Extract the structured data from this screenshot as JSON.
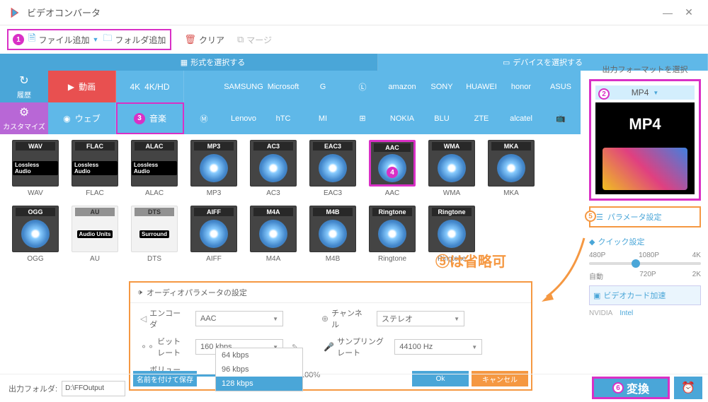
{
  "titlebar": {
    "title": "ビデオコンバータ"
  },
  "toolbar": {
    "add_file": "ファイル追加",
    "add_folder": "フォルダ追加",
    "clear": "クリア",
    "merge": "マージ",
    "num1": "1"
  },
  "tabs": {
    "format": "形式を選択する",
    "device": "デバイスを選択する"
  },
  "sidebar": {
    "history": "履歴",
    "customize": "カスタマイズ"
  },
  "cats": {
    "video": "動画",
    "video4k": "4K/HD",
    "web": "ウェブ",
    "music": "音楽",
    "num3": "3"
  },
  "brands_row1": [
    "",
    "SAMSUNG",
    "Microsoft",
    "G",
    "",
    "amazon",
    "SONY",
    "HUAWEI",
    "honor",
    "ASUS"
  ],
  "brands_row2": [
    "",
    "Lenovo",
    "hTC",
    "MI",
    "",
    "NOKIA",
    "BLU",
    "ZTE",
    "alcatel",
    "TV"
  ],
  "formats": [
    {
      "name": "WAV",
      "light": false,
      "sub": "Lossless Audio"
    },
    {
      "name": "FLAC",
      "light": false,
      "sub": "Lossless Audio"
    },
    {
      "name": "ALAC",
      "light": false,
      "sub": "Lossless Audio"
    },
    {
      "name": "MP3",
      "light": false
    },
    {
      "name": "AC3",
      "light": false
    },
    {
      "name": "EAC3",
      "light": false
    },
    {
      "name": "AAC",
      "light": false,
      "hl": true,
      "num": "4"
    },
    {
      "name": "WMA",
      "light": false
    },
    {
      "name": "MKA",
      "light": false
    },
    {
      "name": "OGG",
      "light": false
    },
    {
      "name": "AU",
      "light": true,
      "sub": "Audio Units"
    },
    {
      "name": "DTS",
      "light": true,
      "sub": "Surround"
    },
    {
      "name": "AIFF",
      "light": false
    },
    {
      "name": "M4A",
      "light": false
    },
    {
      "name": "M4B",
      "light": false
    },
    {
      "name": "Ringtone",
      "light": false,
      "icon": "apple"
    },
    {
      "name": "Ringtone",
      "light": false,
      "icon": "android"
    }
  ],
  "right": {
    "title": "出力フォーマットを選択",
    "format": "MP4",
    "thumb_text": "MP4",
    "num2": "2",
    "param_btn": "パラメータ設定",
    "num5": "5",
    "quick_title": "クイック設定",
    "presets1": [
      "480P",
      "1080P",
      "4K"
    ],
    "presets2": [
      "自動",
      "720P",
      "2K"
    ],
    "gpu": "ビデオカード加速",
    "nvidia": "NVIDIA",
    "intel": "Intel"
  },
  "note": "⑤は省略可",
  "dialog": {
    "title": "オーディオパラメータの設定",
    "encoder": "エンコーダ",
    "encoder_val": "AAC",
    "bitrate": "ビットレート",
    "bitrate_val": "160 kbps",
    "channel": "チャンネル",
    "channel_val": "ステレオ",
    "sample": "サンプリングレート",
    "sample_val": "44100 Hz",
    "volume": "ボリューム",
    "volume_val": "100%",
    "options": [
      "64 kbps",
      "96 kbps",
      "128 kbps"
    ],
    "save_as": "名前を付けて保存",
    "ok": "Ok",
    "cancel": "キャンセル"
  },
  "bottom": {
    "out_label": "出力フォルダ:",
    "out_path": "D:\\FFOutput",
    "convert": "変換",
    "num6": "6"
  }
}
